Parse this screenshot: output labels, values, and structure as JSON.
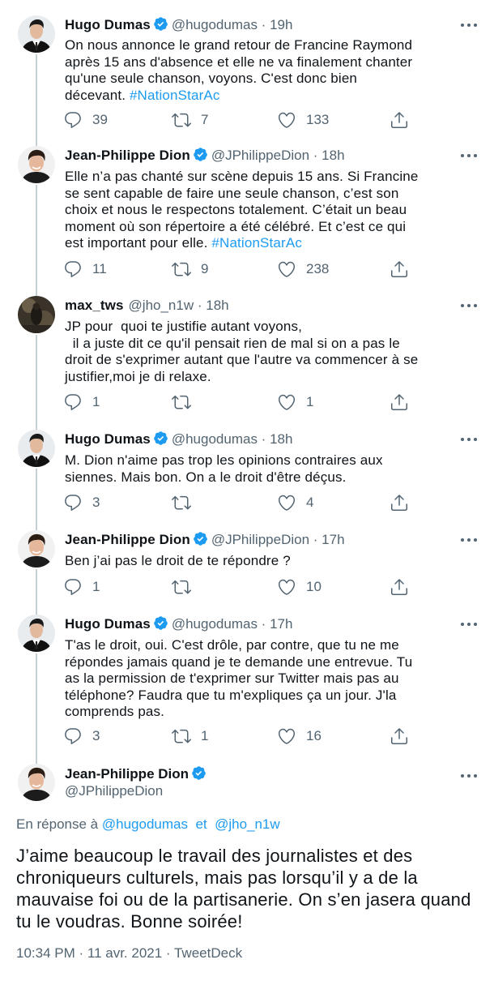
{
  "replies": [
    {
      "name": "Hugo Dumas",
      "handle": "@hugodumas",
      "time": "19h",
      "text": "On nous annonce le grand retour de Francine Raymond\naprès 15 ans d'absence et elle ne va finalement chanter\nqu'une seule chanson, voyons. C'est donc bien\ndécevant. ",
      "hashtag": "#NationStarAc",
      "reply_count": "39",
      "retweet_count": "7",
      "like_count": "133"
    },
    {
      "name": "Jean-Philippe Dion",
      "handle": "@JPhilippeDion",
      "time": "18h",
      "text": "Elle n’a pas chanté sur scène depuis 15 ans. Si Francine\nse sent capable de faire une seule chanson, c’est son\nchoix et nous le respectons totalement. C’était un beau\nmoment où son répertoire a été célébré. Et c’est ce qui\nest important pour elle. ",
      "hashtag": "#NationStarAc",
      "reply_count": "11",
      "retweet_count": "9",
      "like_count": "238"
    },
    {
      "name": "max_tws",
      "handle": "@jho_n1w",
      "time": "18h",
      "text": "JP pour  quoi te justifie autant voyons,\n  il a juste dit ce qu'il pensait rien de mal si on a pas le\ndroit de s'exprimer autant que l'autre va commencer à se\njustifier,moi je di relaxe.",
      "hashtag": "",
      "reply_count": "1",
      "retweet_count": "",
      "like_count": "1"
    },
    {
      "name": "Hugo Dumas",
      "handle": "@hugodumas",
      "time": "18h",
      "text": "M. Dion n'aime pas trop les opinions contraires aux\nsiennes. Mais bon. On a le droit d'être déçus.",
      "hashtag": "",
      "reply_count": "3",
      "retweet_count": "",
      "like_count": "4"
    },
    {
      "name": "Jean-Philippe Dion",
      "handle": "@JPhilippeDion",
      "time": "17h",
      "text": "Ben j’ai pas le droit de te répondre ?",
      "hashtag": "",
      "reply_count": "1",
      "retweet_count": "",
      "like_count": "10"
    },
    {
      "name": "Hugo Dumas",
      "handle": "@hugodumas",
      "time": "17h",
      "text": "T'as le droit, oui. C'est drôle, par contre, que tu ne me\nrépondes jamais quand je te demande une entrevue. Tu\nas la permission de t'exprimer sur Twitter mais pas au\ntéléphone? Faudra que tu m'expliques ça un jour. J'la\ncomprends pas.",
      "hashtag": "",
      "reply_count": "3",
      "retweet_count": "1",
      "like_count": "16"
    }
  ],
  "main_tweet": {
    "name": "Jean-Philippe Dion",
    "handle": "@JPhilippeDion",
    "reply_prefix": "En réponse à",
    "reply_mention_1": "@hugodumas",
    "reply_and": "et",
    "reply_mention_2": "@jho_n1w",
    "text": "J’aime beaucoup le travail des journalistes et des chroniqueurs culturels, mais pas lorsqu’il y a de la mauvaise foi ou de la partisanerie. On s’en jasera quand tu le voudras. Bonne soirée!",
    "timestamp": "10:34 PM · 11 avr. 2021 · TweetDeck"
  },
  "separator": " · ",
  "colors": {
    "link": "#1d9bf0",
    "secondary_text": "#536471",
    "thread_line": "#c4cfd6",
    "verified": "#1d9bf0"
  },
  "icons": [
    "reply-icon",
    "retweet-icon",
    "like-icon",
    "share-icon",
    "more-icon",
    "verified-badge-icon"
  ]
}
